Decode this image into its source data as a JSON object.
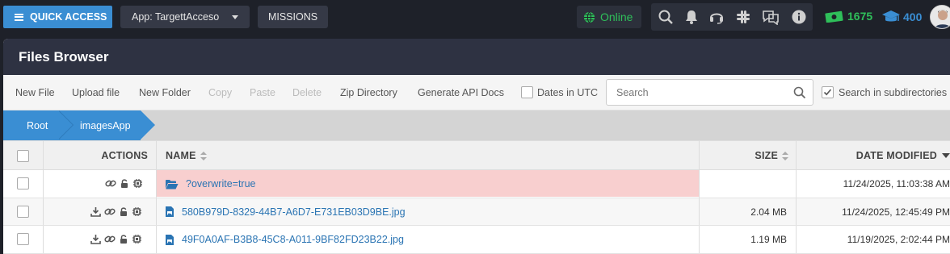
{
  "topbar": {
    "quick_access_label": "QUICK ACCESS",
    "app_selector_label": "App: TargettAcceso",
    "missions_label": "MISSIONS",
    "status_label": "Online",
    "status_color": "#2fbf5a",
    "icons": [
      "search-icon",
      "bell-icon",
      "headset-icon",
      "slack-icon",
      "chat-icon",
      "info-icon"
    ],
    "money_count": "1675",
    "graduation_count": "400"
  },
  "panel": {
    "title": "Files Browser"
  },
  "toolbar": {
    "new_file": "New File",
    "upload_file": "Upload file",
    "new_folder": "New Folder",
    "copy": "Copy",
    "paste": "Paste",
    "delete": "Delete",
    "zip_directory": "Zip Directory",
    "generate_api_docs": "Generate API Docs",
    "dates_utc_label": "Dates in UTC",
    "dates_utc_checked": false,
    "search_placeholder": "Search",
    "search_value": "",
    "subdirs_label": "Search in subdirectories",
    "subdirs_checked": true
  },
  "breadcrumb": [
    "Root",
    "imagesApp"
  ],
  "table": {
    "columns": {
      "actions": "ACTIONS",
      "name": "NAME",
      "size": "SIZE",
      "date": "DATE MODIFIED"
    },
    "rows": [
      {
        "type": "folder",
        "name": "?overwrite=true",
        "size": "",
        "date": "11/24/2025, 11:03:38 AM",
        "actions": [
          "link-icon",
          "lock-icon",
          "chip-icon"
        ]
      },
      {
        "type": "file",
        "name": "580B979D-8329-44B7-A6D7-E731EB03D9BE.jpg",
        "size": "2.04 MB",
        "date": "11/24/2025, 12:45:49 PM",
        "actions": [
          "download-icon",
          "link-icon",
          "lock-icon",
          "chip-icon"
        ]
      },
      {
        "type": "file",
        "name": "49F0A0AF-B3B8-45C8-A011-9BF82FD23B22.jpg",
        "size": "1.19 MB",
        "date": "11/19/2025, 2:02:44 PM",
        "actions": [
          "download-icon",
          "link-icon",
          "lock-icon",
          "chip-icon"
        ]
      }
    ]
  },
  "colors": {
    "accent": "#3a8ed3",
    "folder_highlight": "#f8cfcf",
    "link": "#2a74b3"
  }
}
